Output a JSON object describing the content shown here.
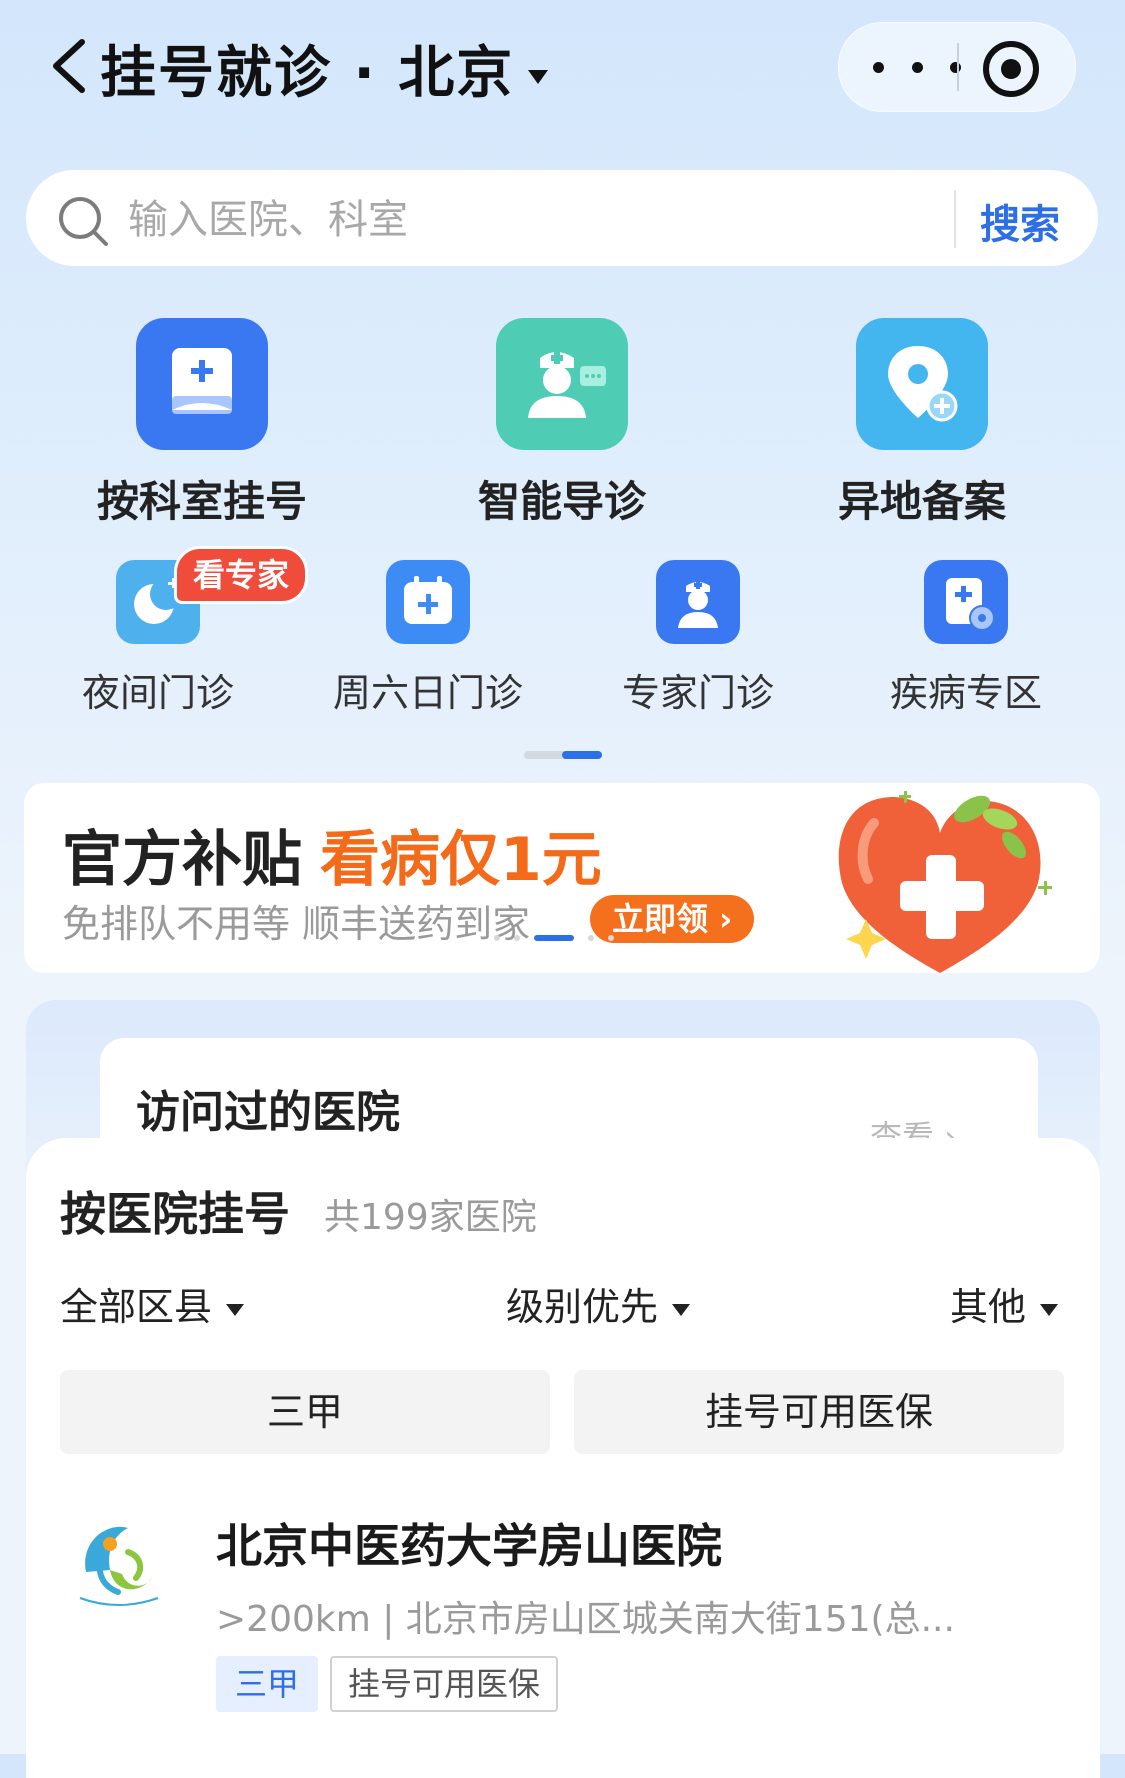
{
  "header": {
    "title": "挂号就诊 · 北京",
    "back_icon": "chevron-left-icon",
    "more_icon": "more-dots-icon",
    "record_icon": "record-icon"
  },
  "search": {
    "placeholder": "输入医院、科室",
    "button_label": "搜索"
  },
  "main_entries": [
    {
      "label": "按科室挂号",
      "icon": "department-register-icon",
      "color": "#3a78f2"
    },
    {
      "label": "智能导诊",
      "icon": "nurse-guide-icon",
      "color": "#4fcdb4"
    },
    {
      "label": "异地备案",
      "icon": "location-plus-icon",
      "color": "#44b6ef"
    }
  ],
  "sub_entries": [
    {
      "label": "夜间门诊",
      "icon": "moon-icon",
      "color": "#4fb0ee",
      "badge": "看专家"
    },
    {
      "label": "周六日门诊",
      "icon": "calendar-plus-icon",
      "color": "#3d8bf5"
    },
    {
      "label": "专家门诊",
      "icon": "doctor-icon",
      "color": "#3a78f2"
    },
    {
      "label": "疾病专区",
      "icon": "disease-doc-icon",
      "color": "#3a78f2"
    }
  ],
  "banner": {
    "title": "官方补贴",
    "highlight": "看病仅1元",
    "subtitle": "免排队不用等 顺丰送药到家",
    "cta": "立即领 ›",
    "image_icon": "heart-medical-cross-icon",
    "accent_color": "#f46a1b"
  },
  "visited": {
    "title": "访问过的医院",
    "more": "查看 ›"
  },
  "hospital_list": {
    "title": "按医院挂号",
    "count": "共199家医院",
    "filters": [
      "全部区县",
      "级别优先",
      "其他"
    ],
    "chips": [
      "三甲",
      "挂号可用医保"
    ],
    "items": [
      {
        "name": "北京中医药大学房山医院",
        "meta": ">200km | 北京市房山区城关南大街151(总...",
        "tags": [
          "三甲",
          "挂号可用医保"
        ],
        "logo_icon": "hospital-logo-icon"
      }
    ]
  },
  "colors": {
    "primary": "#2c6fe6",
    "badge_red": "#ef4c3b",
    "cta_orange": "#f4701d"
  }
}
